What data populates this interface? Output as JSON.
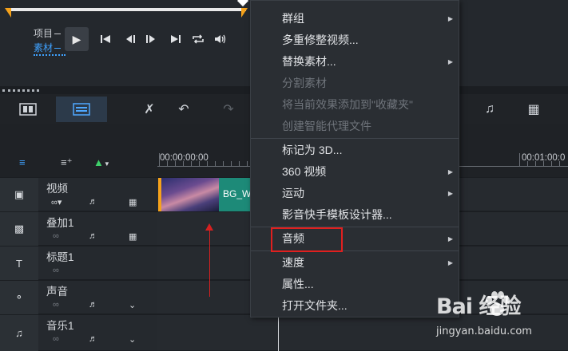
{
  "player": {
    "mode_project": "项目",
    "mode_clip": "素材",
    "controls": [
      "play-icon",
      "skip-to-start-icon",
      "step-back-icon",
      "step-forward-icon",
      "skip-to-end-icon",
      "repeat-icon",
      "volume-icon"
    ]
  },
  "toolbar": {
    "icons": [
      "storyboard-view-icon",
      "timeline-view-icon",
      "tools-icon",
      "undo-icon",
      "redo-icon",
      "audio-waveform-icon",
      "film-icon"
    ]
  },
  "ruler": {
    "start_label": "00:00:00:00",
    "end_label": "00:01:00:0"
  },
  "tracks": [
    {
      "name": "视频"
    },
    {
      "name": "叠加1"
    },
    {
      "name": "标题1"
    },
    {
      "name": "声音"
    },
    {
      "name": "音乐1"
    }
  ],
  "clip": {
    "name": "BG_W"
  },
  "context_menu": {
    "items": [
      {
        "label": "群组",
        "submenu": true,
        "disabled": false
      },
      {
        "label": "多重修整视频...",
        "submenu": false,
        "disabled": false
      },
      {
        "label": "替换素材...",
        "submenu": true,
        "disabled": false
      },
      {
        "label": "分割素材",
        "submenu": false,
        "disabled": true
      },
      {
        "label": "将当前效果添加到\"收藏夹\"",
        "submenu": false,
        "disabled": true
      },
      {
        "label": "创建智能代理文件",
        "submenu": false,
        "disabled": true
      },
      {
        "label": "标记为 3D...",
        "submenu": false,
        "disabled": false
      },
      {
        "label": "360 视频",
        "submenu": true,
        "disabled": false
      },
      {
        "label": "运动",
        "submenu": true,
        "disabled": false
      },
      {
        "label": "影音快手模板设计器...",
        "submenu": false,
        "disabled": false
      },
      {
        "label": "音频",
        "submenu": true,
        "disabled": false
      },
      {
        "label": "速度",
        "submenu": true,
        "disabled": false
      },
      {
        "label": "属性...",
        "submenu": false,
        "disabled": false
      },
      {
        "label": "打开文件夹...",
        "submenu": false,
        "disabled": false
      }
    ]
  },
  "watermark": {
    "logo": "Bai  经验",
    "url": "jingyan.baidu.com"
  },
  "colors": {
    "accent_blue": "#3fa2ff",
    "trim_orange": "#f5a21b",
    "clip_teal": "#1d8a78",
    "annotation_red": "#e0201f"
  }
}
